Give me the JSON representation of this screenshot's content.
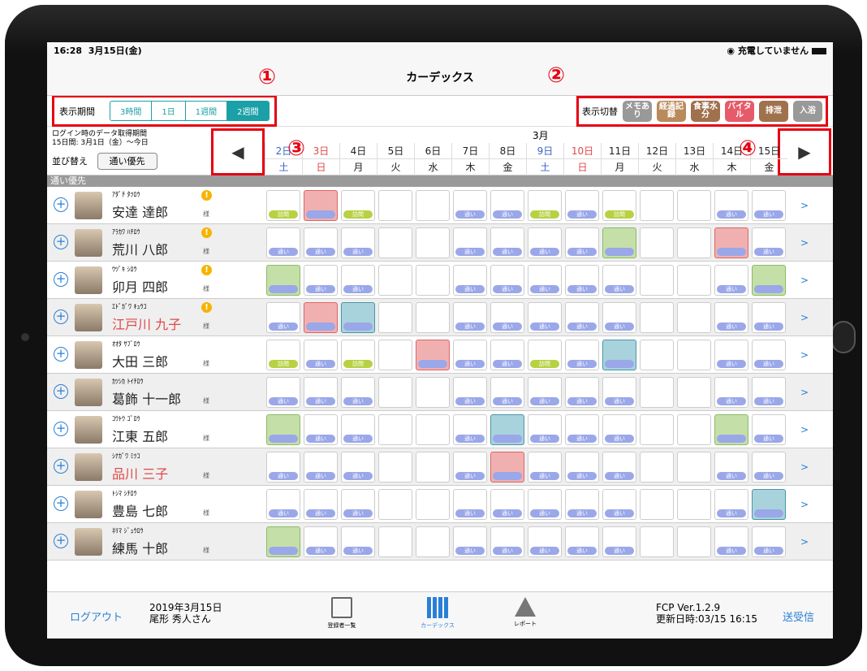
{
  "status": {
    "time": "16:28",
    "date": "3月15日(金)",
    "battery": "充電していません"
  },
  "title": "カーデックス",
  "markers": {
    "m1": "①",
    "m2": "②",
    "m3": "③",
    "m4": "④"
  },
  "period": {
    "label": "表示期間",
    "options": [
      "3時間",
      "1日",
      "1週間",
      "2週間"
    ],
    "selected": "2週間"
  },
  "switch": {
    "label": "表示切替",
    "chips": [
      "メモあり",
      "経過記録",
      "食事水分",
      "バイタル",
      "排泄",
      "入浴"
    ]
  },
  "info": {
    "line1": "ログイン時のデータ取得期間",
    "line2": "15日間:  3月1日（金）～今日",
    "sort_label": "並び替え",
    "sort_value": "通い優先"
  },
  "month": "3月",
  "days": [
    {
      "d": "2日",
      "w": "土",
      "c": "#3a64c8"
    },
    {
      "d": "3日",
      "w": "日",
      "c": "#e04848"
    },
    {
      "d": "4日",
      "w": "月",
      "c": "#222"
    },
    {
      "d": "5日",
      "w": "火",
      "c": "#222"
    },
    {
      "d": "6日",
      "w": "水",
      "c": "#222"
    },
    {
      "d": "7日",
      "w": "木",
      "c": "#222"
    },
    {
      "d": "8日",
      "w": "金",
      "c": "#222"
    },
    {
      "d": "9日",
      "w": "土",
      "c": "#3a64c8"
    },
    {
      "d": "10日",
      "w": "日",
      "c": "#e04848"
    },
    {
      "d": "11日",
      "w": "月",
      "c": "#222"
    },
    {
      "d": "12日",
      "w": "火",
      "c": "#222"
    },
    {
      "d": "13日",
      "w": "水",
      "c": "#222"
    },
    {
      "d": "14日",
      "w": "木",
      "c": "#222"
    },
    {
      "d": "15日",
      "w": "金",
      "c": "#222"
    }
  ],
  "section": "通い優先",
  "sama": "様",
  "pill_tsuu": "通い",
  "pill_houmon": "訪問",
  "residents": [
    {
      "kana": "ｱﾀﾞﾁ ﾀﾂﾛｳ",
      "name": "安達 達郎",
      "warn": true,
      "red": false,
      "cells": [
        "h",
        "pink",
        "h",
        "",
        "",
        "t",
        "t",
        "h",
        "t",
        "h",
        "",
        "",
        "t",
        "t"
      ]
    },
    {
      "kana": "ｱﾗｶﾜ ﾊﾁﾛｳ",
      "name": "荒川 八郎",
      "warn": true,
      "red": false,
      "cells": [
        "t",
        "t",
        "t",
        "",
        "",
        "t",
        "t",
        "t",
        "t",
        "green",
        "",
        "",
        "pink",
        "t"
      ]
    },
    {
      "kana": "ｳﾂﾞｷ ｼﾛｳ",
      "name": "卯月 四郎",
      "warn": true,
      "red": false,
      "cells": [
        "green",
        "t",
        "t",
        "",
        "",
        "t",
        "t",
        "t",
        "t",
        "t",
        "",
        "",
        "t",
        "green"
      ]
    },
    {
      "kana": "ｴﾄﾞｶﾞﾜ ｷｭｳｺ",
      "name": "江戸川 九子",
      "warn": true,
      "red": true,
      "cells": [
        "t",
        "pink",
        "blue",
        "",
        "",
        "t",
        "t",
        "t",
        "t",
        "t",
        "",
        "",
        "t",
        "t"
      ]
    },
    {
      "kana": "ｵｵﾀ ｻﾌﾞﾛｳ",
      "name": "大田 三郎",
      "warn": false,
      "red": false,
      "cells": [
        "h",
        "t",
        "h",
        "",
        "pink",
        "t",
        "t",
        "h",
        "t",
        "blue",
        "",
        "",
        "t",
        "t"
      ]
    },
    {
      "kana": "ｶﾂｼｶ ﾄｲﾁﾛｳ",
      "name": "葛飾 十一郎",
      "warn": false,
      "red": false,
      "cells": [
        "t",
        "t",
        "t",
        "",
        "",
        "t",
        "t",
        "t",
        "t",
        "t",
        "",
        "",
        "t",
        "t"
      ]
    },
    {
      "kana": "ｺｳﾄｳ ｺﾞﾛｳ",
      "name": "江東 五郎",
      "warn": false,
      "red": false,
      "cells": [
        "green",
        "t",
        "t",
        "",
        "",
        "t",
        "blue",
        "t",
        "t",
        "t",
        "",
        "",
        "green",
        "t"
      ]
    },
    {
      "kana": "ｼﾅｶﾞﾜ ﾐﾂｺ",
      "name": "品川 三子",
      "warn": false,
      "red": true,
      "cells": [
        "t",
        "t",
        "t",
        "",
        "",
        "t",
        "pink",
        "t",
        "t",
        "t",
        "",
        "",
        "t",
        "t"
      ]
    },
    {
      "kana": "ﾄｼﾏ ｼﾁﾛｳ",
      "name": "豊島 七郎",
      "warn": false,
      "red": false,
      "cells": [
        "t",
        "t",
        "t",
        "",
        "",
        "t",
        "t",
        "t",
        "t",
        "t",
        "",
        "",
        "t",
        "blue"
      ]
    },
    {
      "kana": "ﾈﾘﾏ ｼﾞｭｳﾛｳ",
      "name": "練馬 十郎",
      "warn": false,
      "red": false,
      "cells": [
        "green",
        "t",
        "t",
        "",
        "",
        "t",
        "t",
        "t",
        "t",
        "t",
        "",
        "",
        "t",
        "t"
      ]
    }
  ],
  "footer": {
    "logout": "ログアウト",
    "date": "2019年3月15日",
    "user": "尾形 秀人さん",
    "nav": [
      "登録者一覧",
      "カーデックス",
      "レポート"
    ],
    "version": "FCP Ver.1.2.9",
    "updated": "更新日時:03/15 16:15",
    "send": "送受信"
  }
}
